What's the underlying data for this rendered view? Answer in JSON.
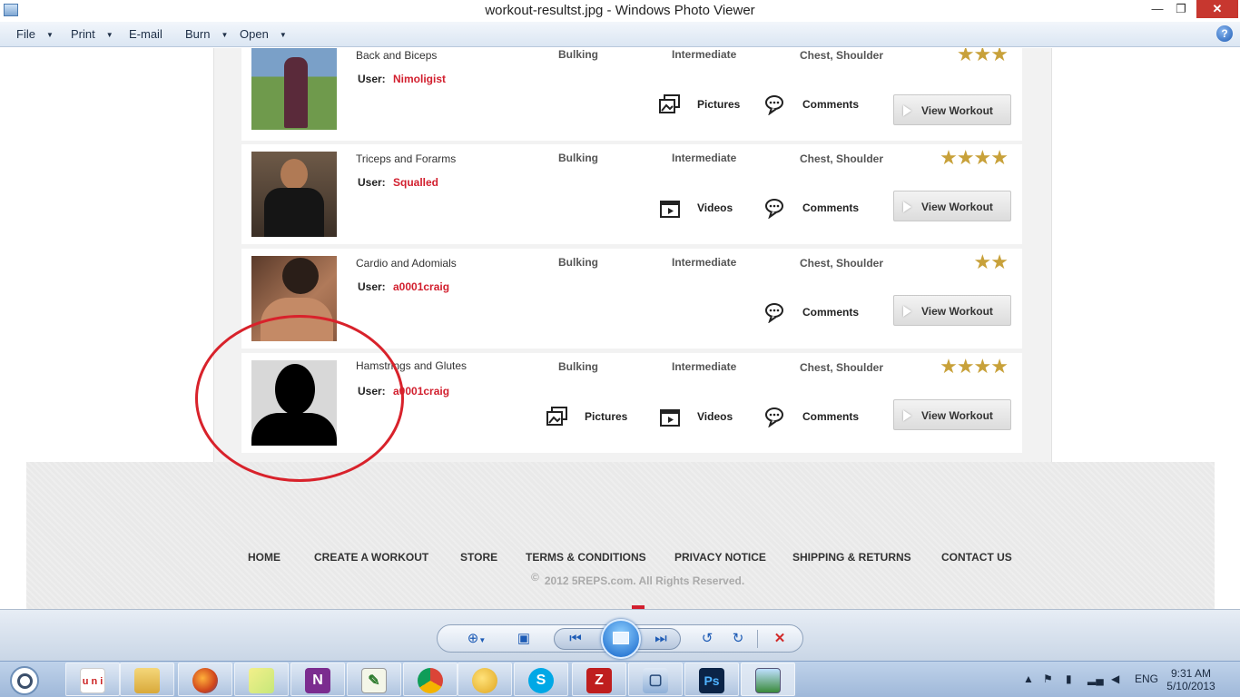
{
  "window": {
    "title": "workout-resultst.jpg - Windows Photo Viewer"
  },
  "menu": {
    "file": "File",
    "print": "Print",
    "email": "E-mail",
    "burn": "Burn",
    "open": "Open"
  },
  "workouts": [
    {
      "name": "Back and Biceps",
      "user_label": "User:",
      "user": "Nimoligist",
      "goal": "Bulking",
      "level": "Intermediate",
      "muscles": "Chest, Shoulder",
      "rating": 3,
      "stars": "★★★",
      "media": [
        "Pictures",
        "Comments"
      ],
      "button": "View Workout"
    },
    {
      "name": "Triceps and Forarms",
      "user_label": "User:",
      "user": "Squalled",
      "goal": "Bulking",
      "level": "Intermediate",
      "muscles": "Chest, Shoulder",
      "rating": 4,
      "stars": "★★★★",
      "media": [
        "Videos",
        "Comments"
      ],
      "button": "View Workout"
    },
    {
      "name": "Cardio and Adomials",
      "user_label": "User:",
      "user": "a0001craig",
      "goal": "Bulking",
      "level": "Intermediate",
      "muscles": "Chest, Shoulder",
      "rating": 2,
      "stars": "★★",
      "media": [
        "Comments"
      ],
      "button": "View Workout"
    },
    {
      "name": "Hamstrings and Glutes",
      "user_label": "User:",
      "user": "a0001craig",
      "goal": "Bulking",
      "level": "Intermediate",
      "muscles": "Chest, Shoulder",
      "rating": 4,
      "stars": "★★★★",
      "media": [
        "Pictures",
        "Videos",
        "Comments"
      ],
      "button": "View Workout"
    }
  ],
  "footer": {
    "nav": [
      "HOME",
      "CREATE A WORKOUT",
      "STORE",
      "TERMS & CONDITIONS",
      "PRIVACY NOTICE",
      "SHIPPING & RETURNS",
      "CONTACT US"
    ],
    "copyright_symbol": "©",
    "copyright": "2012 5REPS.com.  All Rights Reserved."
  },
  "taskbar": {
    "apps": [
      "unknown-app",
      "file-explorer",
      "firefox",
      "sticky-notes",
      "onenote",
      "spreadsheet-app",
      "chrome",
      "app-yellow",
      "skype",
      "filezilla",
      "virtualbox",
      "photoshop",
      "photo-viewer"
    ],
    "language": "ENG",
    "time": "9:31 AM",
    "date": "5/10/2013"
  },
  "colors": {
    "accent_red": "#d21f2e",
    "star_gold": "#c8a13a",
    "annotation_red": "#d8222b"
  }
}
